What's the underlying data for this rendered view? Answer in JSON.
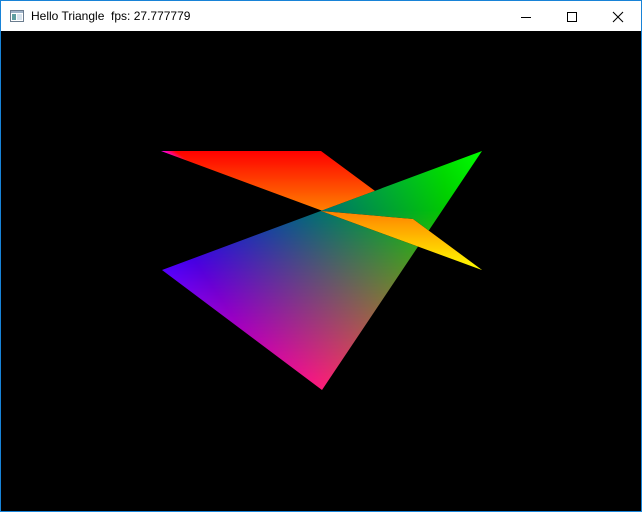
{
  "window": {
    "title": "Hello Triangle  fps: 27.777779"
  },
  "titlebar": {
    "app_icon": "application-window-icon",
    "minimize_icon": "minimize-icon",
    "maximize_icon": "maximize-icon",
    "close_icon": "close-icon"
  },
  "scene": {
    "background_color": "#000000",
    "vertex_colors": [
      "#ff0000",
      "#00ff00",
      "#0000ff"
    ]
  }
}
